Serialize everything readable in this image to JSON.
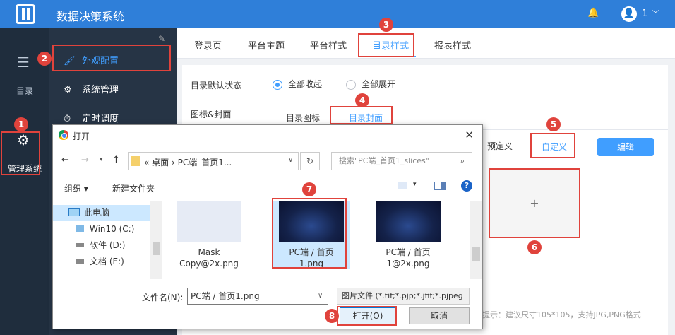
{
  "app": {
    "title": "数据决策系统",
    "user": "1"
  },
  "rail": {
    "catalog_label": "目录",
    "admin_label": "管理系统"
  },
  "nav": {
    "items": [
      {
        "label": "外观配置"
      },
      {
        "label": "系统管理"
      },
      {
        "label": "定时调度"
      }
    ]
  },
  "tabs": [
    "登录页",
    "平台主题",
    "平台样式",
    "目录样式",
    "报表样式"
  ],
  "settings": {
    "default_state_label": "目录默认状态",
    "collapse_all": "全部收起",
    "expand_all": "全部展开",
    "icon_cover_label": "图标&封面",
    "catalog_icon_tab": "目录图标",
    "catalog_cover_tab": "目录封面",
    "predefined_tab": "预定义",
    "custom_tab": "自定义",
    "edit_button": "编辑",
    "plus": "+",
    "hint": "提示：建议尺寸105*105，支持JPG,PNG格式"
  },
  "dialog": {
    "title": "打开",
    "breadcrumb": "«  桌面  ›  PC端_首页1...",
    "search_placeholder": "搜索\"PC端_首页1_slices\"",
    "organize": "组织 ▾",
    "new_folder": "新建文件夹",
    "tree": [
      "此电脑",
      "Win10 (C:)",
      "软件 (D:)",
      "文档 (E:)"
    ],
    "files": [
      {
        "name": "Mask Copy@2x.png"
      },
      {
        "name": "PC端 / 首页1.png"
      },
      {
        "name": "PC端 / 首页1@2x.png"
      }
    ],
    "filename_label": "文件名(N):",
    "filename_value": "PC端 / 首页1.png",
    "filetype": "图片文件 (*.tif;*.pjp;*.jfif;*.pjpeg",
    "open_button": "打开(O)",
    "cancel_button": "取消"
  },
  "badges": [
    "1",
    "2",
    "3",
    "4",
    "5",
    "6",
    "7",
    "8"
  ],
  "colors": {
    "primary": "#2f7fd9",
    "accent": "#409eff",
    "highlight": "#e0433c",
    "sidebar": "#263445"
  }
}
